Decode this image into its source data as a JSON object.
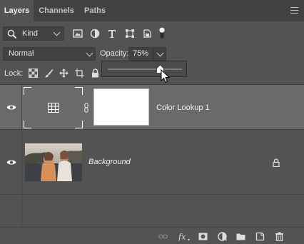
{
  "tabs": [
    {
      "label": "Layers",
      "active": true
    },
    {
      "label": "Channels",
      "active": false
    },
    {
      "label": "Paths",
      "active": false
    }
  ],
  "filter": {
    "kind_label": "Kind"
  },
  "blend": {
    "mode": "Normal",
    "opacity_label": "Opacity:",
    "opacity_value": "75%"
  },
  "opacity_slider": {
    "value_percent": 75
  },
  "lock": {
    "label": "Lock:"
  },
  "layers": [
    {
      "name": "Color Lookup 1",
      "type": "adjustment",
      "selected": true,
      "visible": true
    },
    {
      "name": "Background",
      "type": "image",
      "selected": false,
      "visible": true,
      "locked": true
    }
  ],
  "colors": {
    "panel": "#535353",
    "tabbar": "#424242",
    "selected_row": "#6a6a6a"
  }
}
